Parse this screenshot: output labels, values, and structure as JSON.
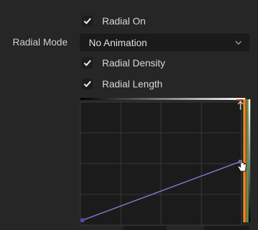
{
  "controls": {
    "radial_on": {
      "label": "Radial On",
      "checked": true
    },
    "radial_mode": {
      "label": "Radial Mode",
      "value": "No Animation"
    },
    "radial_density": {
      "label": "Radial Density",
      "checked": true
    },
    "radial_length": {
      "label": "Radial Length",
      "checked": true
    }
  },
  "curve": {
    "line_color": "#8a6fc4",
    "grid_color": "#3a3a3a",
    "background": "#1b1b1b",
    "left_point": {
      "x": 0.0,
      "y": 0.0
    },
    "right_point": {
      "x": 1.0,
      "y": 0.48
    }
  },
  "icons": {
    "checkbox_check": "check-icon",
    "dropdown_arrow": "chevron-down-icon",
    "cursor": "cursor-pointer-icon",
    "top_marker": "arrow-up-icon"
  }
}
